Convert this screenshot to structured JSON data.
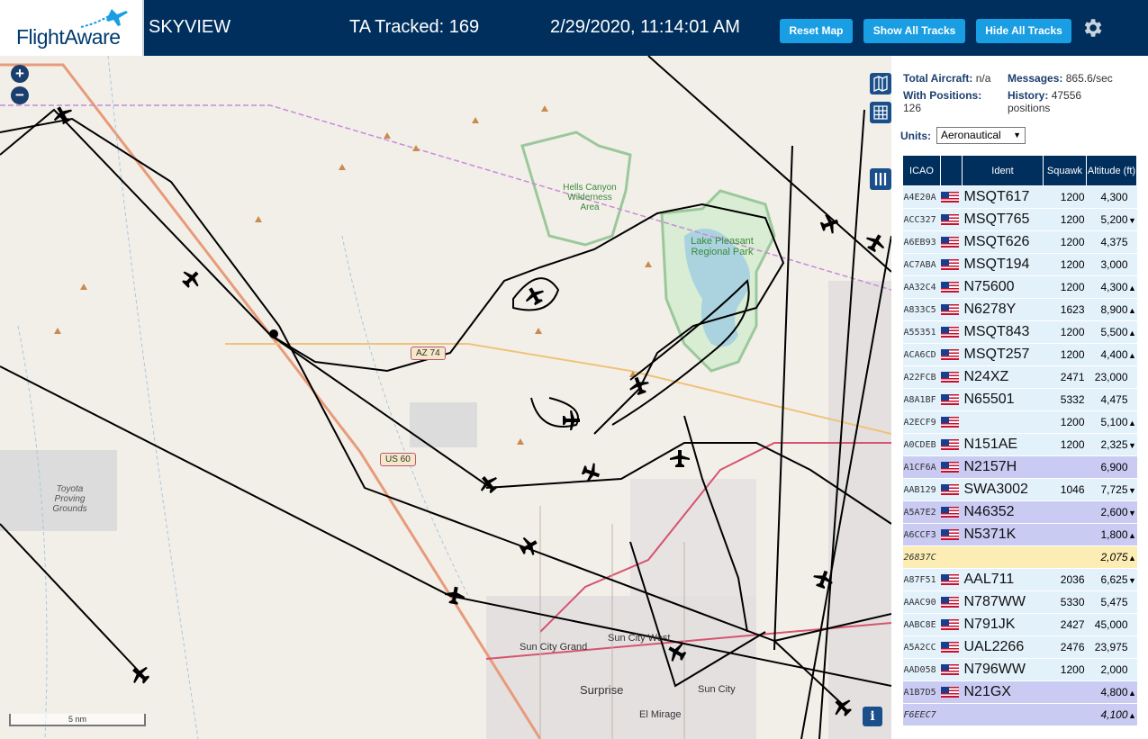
{
  "header": {
    "logo": "FlightAware",
    "site_name": "SKYVIEW",
    "ta_tracked": "TA Tracked: 169",
    "clock": "2/29/2020, 11:14:01 AM",
    "buttons": {
      "reset": "Reset Map",
      "show_all": "Show All Tracks",
      "hide_all": "Hide All Tracks"
    }
  },
  "map": {
    "zoom_in": "+",
    "zoom_out": "−",
    "scale": "5 nm",
    "info": "i",
    "labels": {
      "hells_canyon": "Hells Canyon Wilderness Area",
      "lake_pleasant": "Lake Pleasant Regional Park",
      "toyota": "Toyota Proving Grounds",
      "az74": "AZ 74",
      "us60": "US 60",
      "sun_city_grand": "Sun City Grand",
      "sun_city_west": "Sun City West",
      "sun_city": "Sun City",
      "surprise": "Surprise",
      "el_mirage": "El Mirage"
    }
  },
  "panel": {
    "total_label": "Total Aircraft:",
    "total_value": "n/a",
    "messages_label": "Messages:",
    "messages_value": "865.6/sec",
    "positions_label": "With Positions:",
    "positions_value": "126",
    "history_label": "History:",
    "history_value": "47556 positions",
    "units_label": "Units:",
    "units_value": "Aeronautical",
    "columns": [
      "ICAO",
      "",
      "Ident",
      "Squawk",
      "Altitude (ft)"
    ],
    "rows": [
      {
        "icao": "A4E20A",
        "flag": true,
        "ident": "MSQT617",
        "squawk": "1200",
        "alt": "4,300",
        "trend": "",
        "style": "blue"
      },
      {
        "icao": "ACC327",
        "flag": true,
        "ident": "MSQT765",
        "squawk": "1200",
        "alt": "5,200",
        "trend": "▼",
        "style": "blue"
      },
      {
        "icao": "A6EB93",
        "flag": true,
        "ident": "MSQT626",
        "squawk": "1200",
        "alt": "4,375",
        "trend": "",
        "style": "blue"
      },
      {
        "icao": "AC7ABA",
        "flag": true,
        "ident": "MSQT194",
        "squawk": "1200",
        "alt": "3,000",
        "trend": "",
        "style": "blue"
      },
      {
        "icao": "AA32C4",
        "flag": true,
        "ident": "N75600",
        "squawk": "1200",
        "alt": "4,300",
        "trend": "▲",
        "style": "blue"
      },
      {
        "icao": "A833C5",
        "flag": true,
        "ident": "N6278Y",
        "squawk": "1623",
        "alt": "8,900",
        "trend": "▲",
        "style": "blue"
      },
      {
        "icao": "A55351",
        "flag": true,
        "ident": "MSQT843",
        "squawk": "1200",
        "alt": "5,500",
        "trend": "▲",
        "style": "blue"
      },
      {
        "icao": "ACA6CD",
        "flag": true,
        "ident": "MSQT257",
        "squawk": "1200",
        "alt": "4,400",
        "trend": "▲",
        "style": "blue"
      },
      {
        "icao": "A22FCB",
        "flag": true,
        "ident": "N24XZ",
        "squawk": "2471",
        "alt": "23,000",
        "trend": "",
        "style": "blue"
      },
      {
        "icao": "A8A1BF",
        "flag": true,
        "ident": "N65501",
        "squawk": "5332",
        "alt": "4,475",
        "trend": "",
        "style": "blue"
      },
      {
        "icao": "A2ECF9",
        "flag": true,
        "ident": "",
        "squawk": "1200",
        "alt": "5,100",
        "trend": "▲",
        "style": "blue"
      },
      {
        "icao": "A0CDEB",
        "flag": true,
        "ident": "N151AE",
        "squawk": "1200",
        "alt": "2,325",
        "trend": "▼",
        "style": "blue"
      },
      {
        "icao": "A1CF6A",
        "flag": true,
        "ident": "N2157H",
        "squawk": "",
        "alt": "6,900",
        "trend": "",
        "style": "purple"
      },
      {
        "icao": "AAB129",
        "flag": true,
        "ident": "SWA3002",
        "squawk": "1046",
        "alt": "7,725",
        "trend": "▼",
        "style": "blue"
      },
      {
        "icao": "A5A7E2",
        "flag": true,
        "ident": "N46352",
        "squawk": "",
        "alt": "2,600",
        "trend": "▼",
        "style": "purple"
      },
      {
        "icao": "A6CCF3",
        "flag": true,
        "ident": "N5371K",
        "squawk": "",
        "alt": "1,800",
        "trend": "▲",
        "style": "purple"
      },
      {
        "icao": "26837C",
        "flag": false,
        "ident": "",
        "squawk": "",
        "alt": "2,075",
        "trend": "▲",
        "style": "yellow"
      },
      {
        "icao": "A87F51",
        "flag": true,
        "ident": "AAL711",
        "squawk": "2036",
        "alt": "6,625",
        "trend": "▼",
        "style": "blue"
      },
      {
        "icao": "AAAC90",
        "flag": true,
        "ident": "N787WW",
        "squawk": "5330",
        "alt": "5,475",
        "trend": "",
        "style": "blue"
      },
      {
        "icao": "AABC8E",
        "flag": true,
        "ident": "N791JK",
        "squawk": "2427",
        "alt": "45,000",
        "trend": "",
        "style": "blue"
      },
      {
        "icao": "A5A2CC",
        "flag": true,
        "ident": "UAL2266",
        "squawk": "2476",
        "alt": "23,975",
        "trend": "",
        "style": "blue"
      },
      {
        "icao": "AAD058",
        "flag": true,
        "ident": "N796WW",
        "squawk": "1200",
        "alt": "2,000",
        "trend": "",
        "style": "blue"
      },
      {
        "icao": "A1B7D5",
        "flag": true,
        "ident": "N21GX",
        "squawk": "",
        "alt": "4,800",
        "trend": "▲",
        "style": "purple"
      },
      {
        "icao": "F6EEC7",
        "flag": false,
        "ident": "",
        "squawk": "",
        "alt": "4,100",
        "trend": "▲",
        "style": "purple-italic"
      }
    ]
  },
  "colors": {
    "header": "#002f5d",
    "button": "#1a9ee3",
    "row_blue": "#e3f1fb",
    "row_purple": "#c9cbf3",
    "row_yellow": "#fcedb4"
  }
}
